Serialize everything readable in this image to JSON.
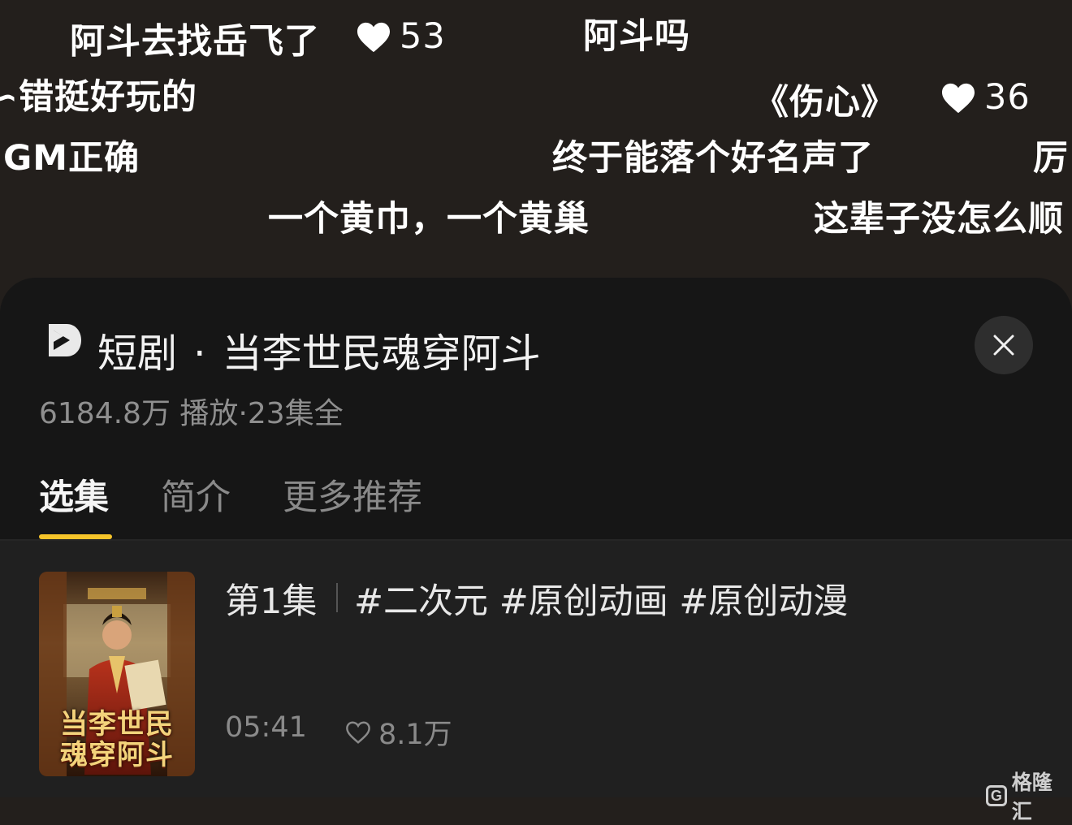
{
  "danmaku": [
    {
      "id": "d1",
      "text": "阿斗去找岳飞了",
      "likes": "53"
    },
    {
      "id": "d2",
      "text": "阿斗吗"
    },
    {
      "id": "d3",
      "text": "∽错挺好玩的"
    },
    {
      "id": "d4",
      "text": "《伤心》",
      "likes": "36"
    },
    {
      "id": "d5",
      "text": "GM正确"
    },
    {
      "id": "d6",
      "text": "终于能落个好名声了"
    },
    {
      "id": "d7",
      "text": "厉"
    },
    {
      "id": "d8",
      "text": "一个黄巾，一个黄巢"
    },
    {
      "id": "d9",
      "text": "这辈子没怎么顺"
    }
  ],
  "sheet": {
    "category": "短剧",
    "title_separator": "·",
    "title": "当李世民魂穿阿斗",
    "views": "6184.8万",
    "views_label": "播放",
    "meta_separator": "·",
    "episode_count": "23集全",
    "close_icon": "close-icon",
    "tabs": [
      {
        "label": "选集",
        "active": true
      },
      {
        "label": "简介",
        "active": false
      },
      {
        "label": "更多推荐",
        "active": false
      }
    ],
    "accent_color": "#f6c42a"
  },
  "episode": {
    "title": "第1集",
    "tags": "#二次元 #原创动画 #原创动漫",
    "duration": "05:41",
    "likes": "8.1万",
    "thumbnail_text_line1": "当李世民",
    "thumbnail_text_line2": "魂穿阿斗"
  },
  "watermark": {
    "box_letter": "G",
    "text": "格隆汇"
  }
}
